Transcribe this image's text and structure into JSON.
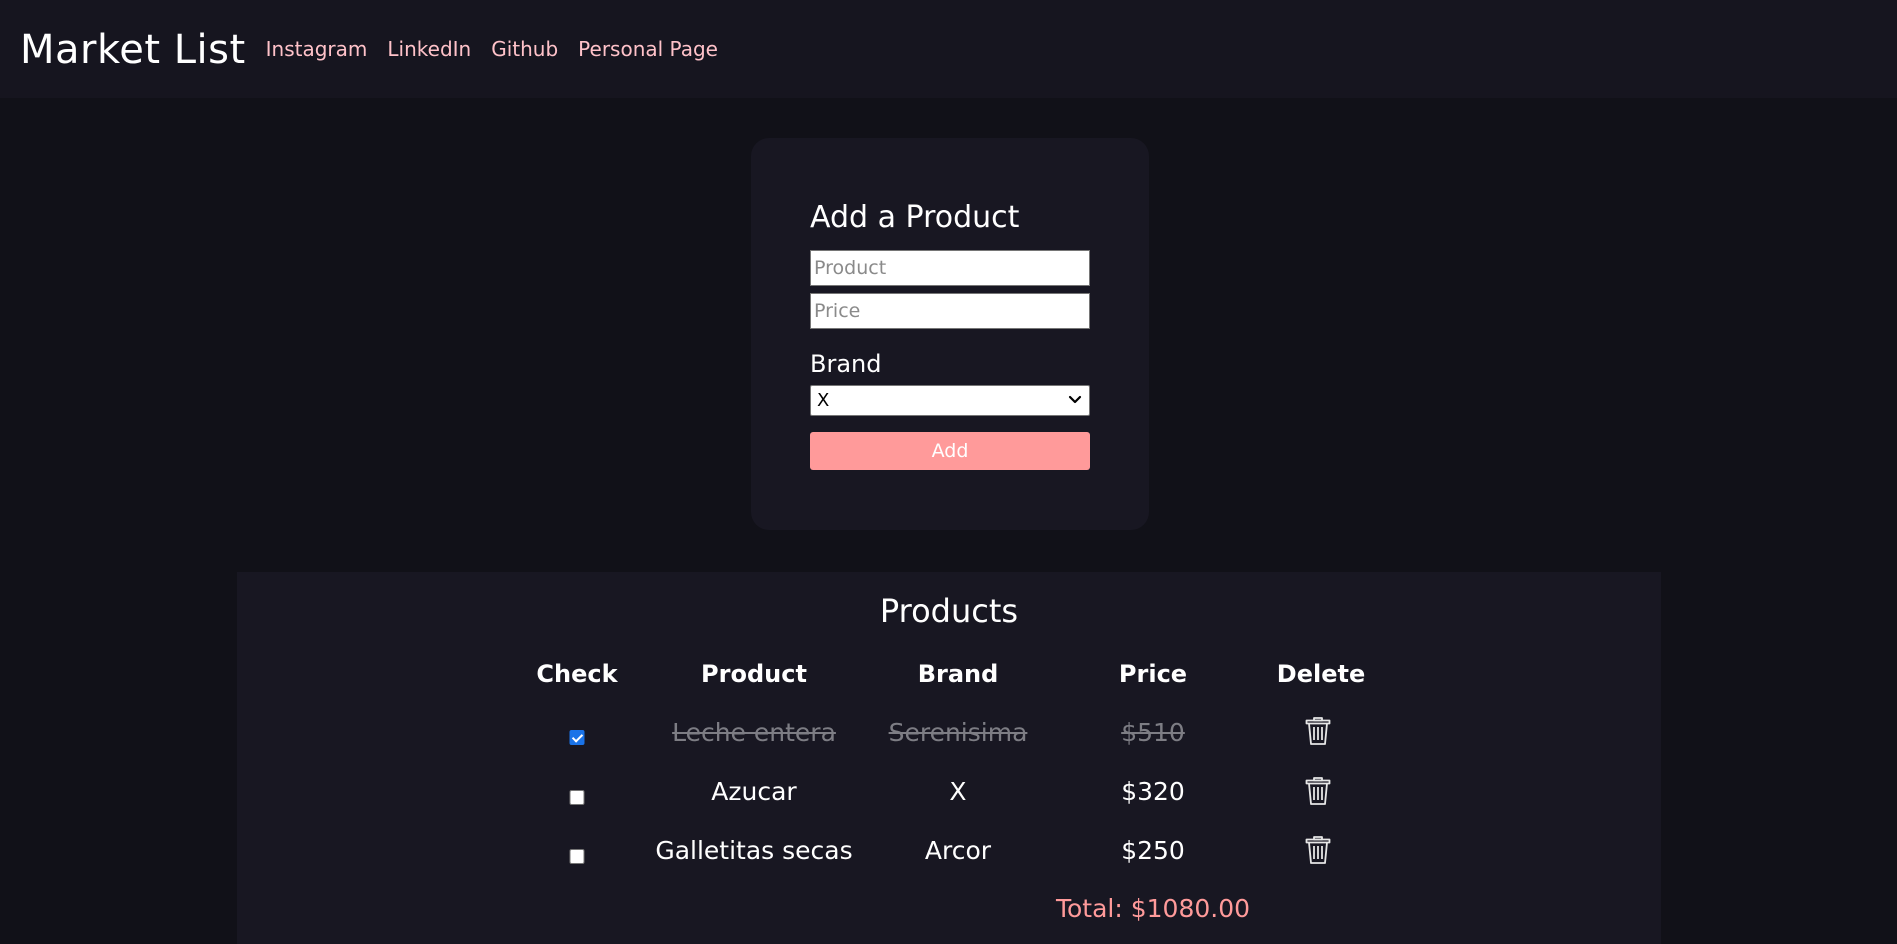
{
  "header": {
    "title": "Market List",
    "links": [
      "Instagram",
      "LinkedIn",
      "Github",
      "Personal Page"
    ]
  },
  "form": {
    "title": "Add a Product",
    "product_placeholder": "Product",
    "price_placeholder": "Price",
    "brand_label": "Brand",
    "brand_selected": "X",
    "add_label": "Add"
  },
  "products": {
    "title": "Products",
    "columns": [
      "Check",
      "Product",
      "Brand",
      "Price",
      "Delete"
    ],
    "rows": [
      {
        "checked": true,
        "product": "Leche entera",
        "brand": "Serenisima",
        "price": "$510"
      },
      {
        "checked": false,
        "product": "Azucar",
        "brand": "X",
        "price": "$320"
      },
      {
        "checked": false,
        "product": "Galletitas secas",
        "brand": "Arcor",
        "price": "$250"
      }
    ],
    "total": "Total: $1080.00"
  },
  "colors": {
    "background": "#111118",
    "header_bg": "#16151f",
    "card_bg": "#181722",
    "link": "#ffc2c9",
    "accent": "#ff9a9a",
    "checkbox_checked": "#1a73e8"
  },
  "icons": {
    "select_arrow": "chevron-down-icon",
    "delete": "trash-icon"
  }
}
